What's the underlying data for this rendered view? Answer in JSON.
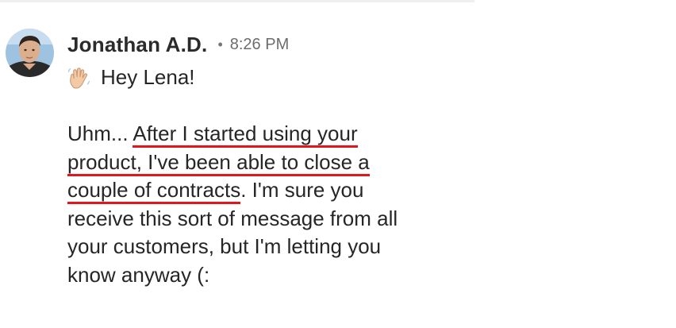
{
  "message": {
    "sender": "Jonathan A.D.",
    "separator": "•",
    "timestamp": "8:26 PM",
    "greeting_icon": "waving-hand-icon",
    "greeting": "Hey Lena!",
    "body": {
      "line1_plain": "Uhm... ",
      "line1_highlight": "After I started using your",
      "line2_highlight": "product, I've been able to close a",
      "line3_highlight": "couple of contracts",
      "line3_plain": ". I'm sure you",
      "line4": "receive this sort of message from all",
      "line5": "your customers, but I'm letting you",
      "line6": "know anyway (:"
    },
    "highlight_color": "#e0171e"
  }
}
